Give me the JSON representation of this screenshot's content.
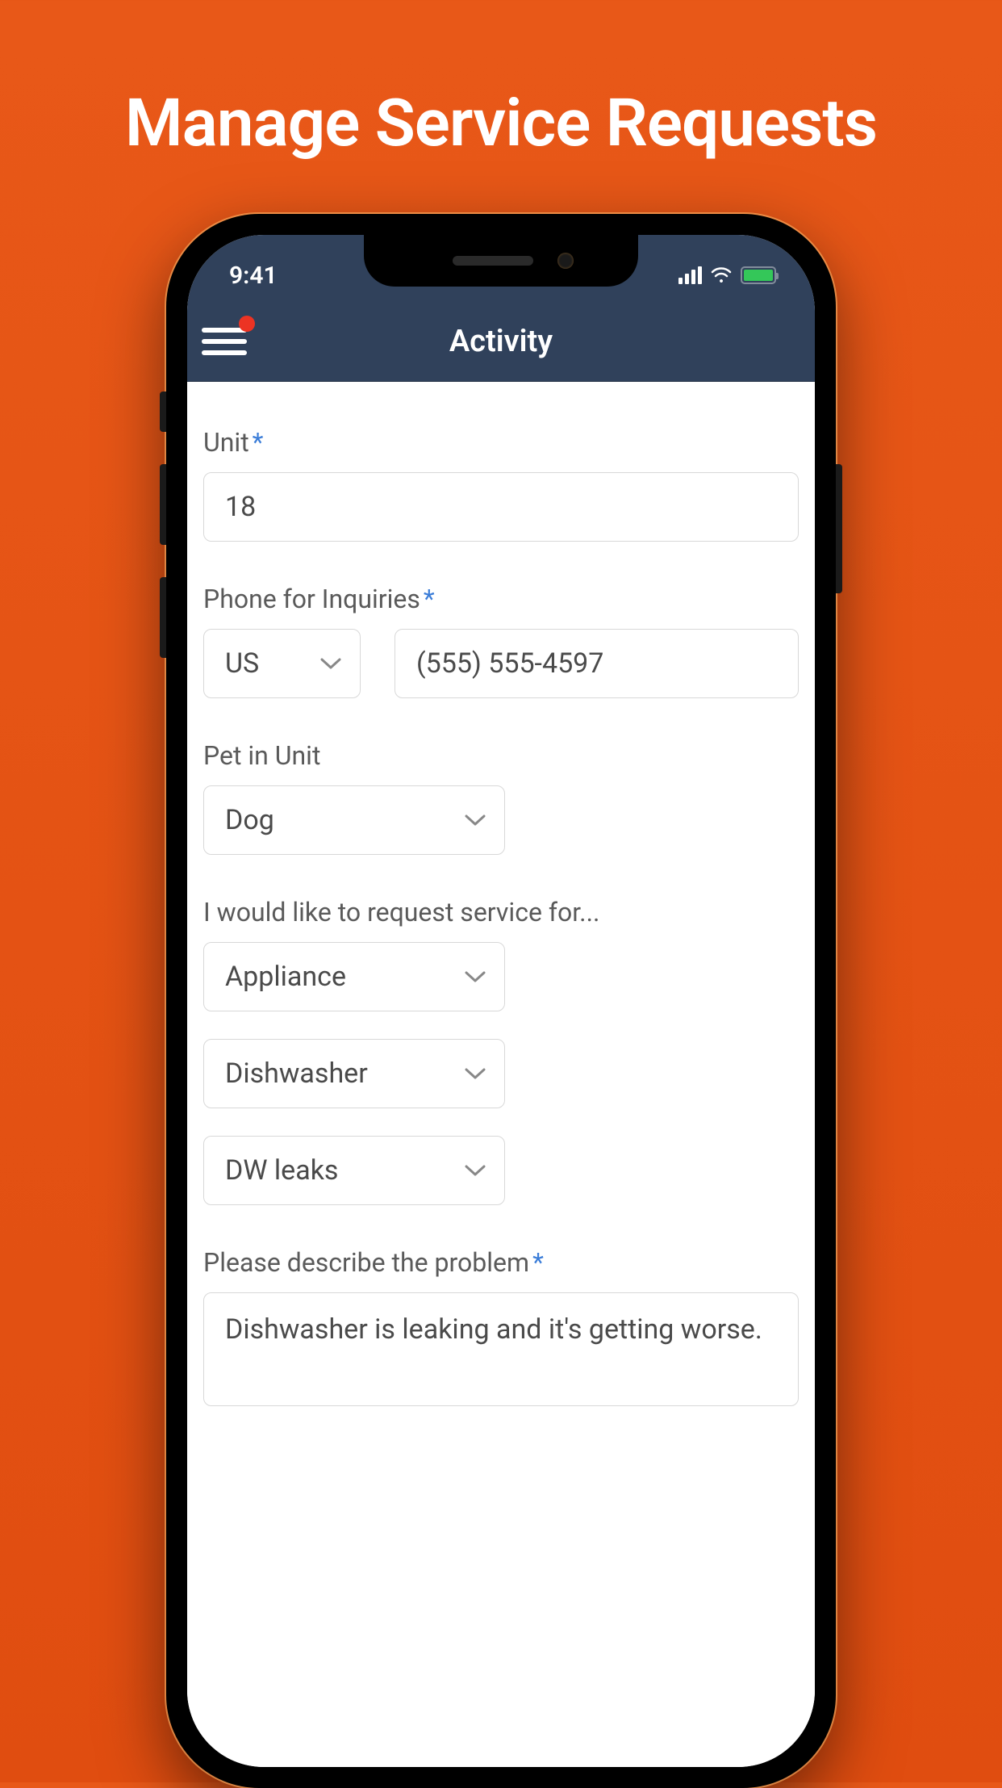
{
  "marketing": {
    "title": "Manage Service Requests"
  },
  "statusBar": {
    "time": "9:41"
  },
  "navBar": {
    "title": "Activity"
  },
  "form": {
    "unit": {
      "label": "Unit",
      "required": "*",
      "value": "18"
    },
    "phone": {
      "label": "Phone for Inquiries",
      "required": "*",
      "countryCode": "US",
      "number": "(555) 555-4597"
    },
    "pet": {
      "label": "Pet in Unit",
      "value": "Dog"
    },
    "serviceFor": {
      "label": "I would like to request service for...",
      "category": "Appliance",
      "item": "Dishwasher",
      "issue": "DW leaks"
    },
    "description": {
      "label": "Please describe the problem",
      "required": "*",
      "value": "Dishwasher is leaking and it's getting worse."
    }
  }
}
